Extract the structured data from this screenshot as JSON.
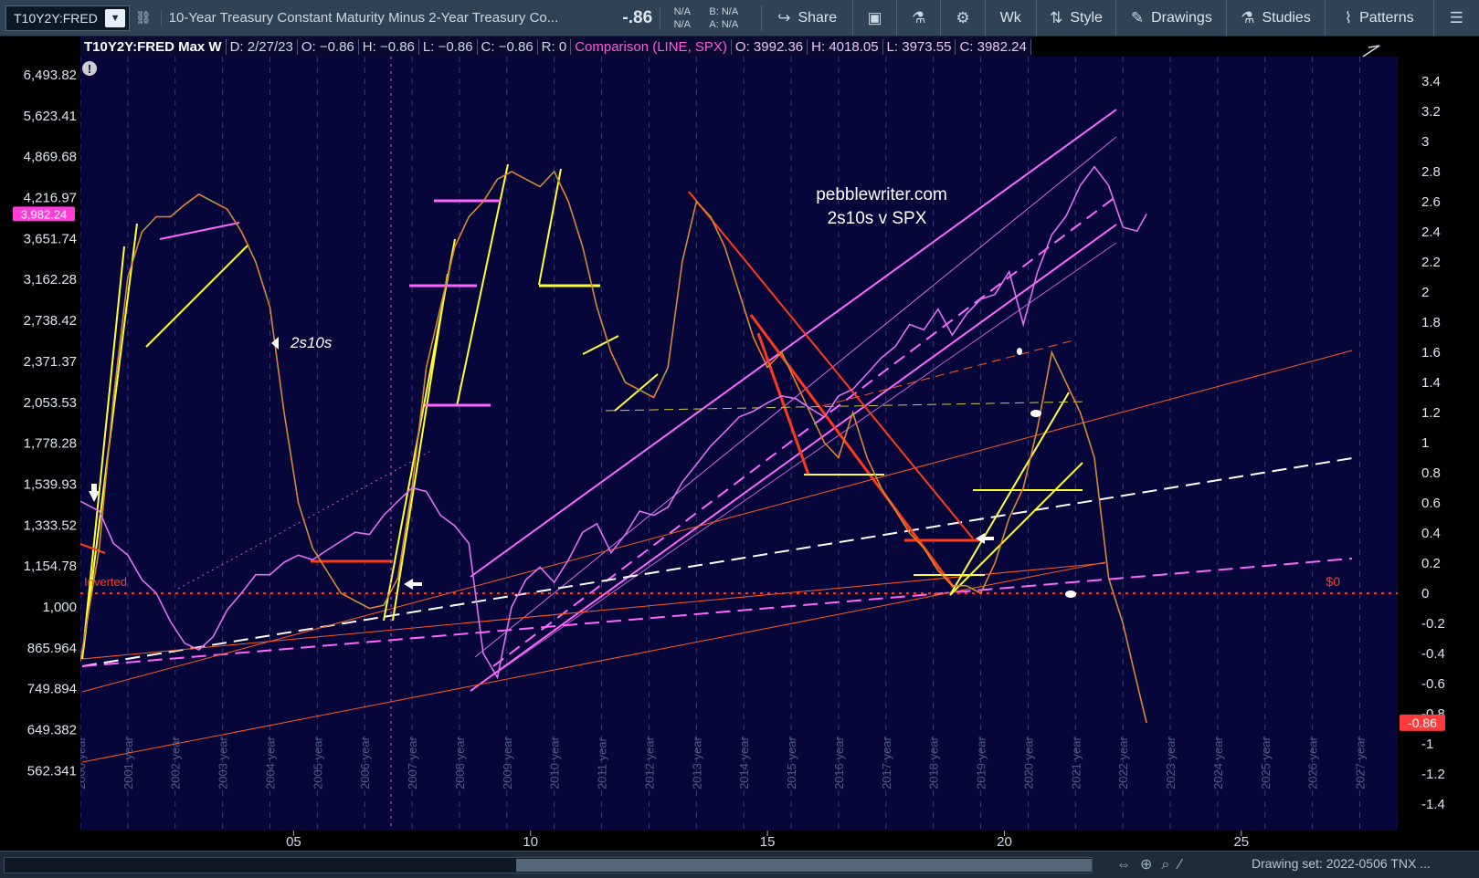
{
  "toolbar": {
    "symbol": "T10Y2Y:FRED",
    "link_icon": "link-icon",
    "description": "10-Year Treasury Constant Maturity Minus 2-Year Treasury Co...",
    "last": "-.86",
    "bid_na": "N/A",
    "ask_na": "N/A",
    "bid": "B: N/A",
    "ask": "A: N/A",
    "share_label": "Share",
    "wk_label": "Wk",
    "style_label": "Style",
    "drawings_label": "Drawings",
    "studies_label": "Studies",
    "patterns_label": "Patterns"
  },
  "header": {
    "symbol": "T10Y2Y:FRED Max W",
    "date": "D: 2/27/23",
    "open": "O: −0.86",
    "high": "H: −0.86",
    "low": "L: −0.86",
    "close": "C: −0.86",
    "r": "R: 0",
    "comparison": "Comparison (LINE, SPX)",
    "cmp_open": "O: 3992.36",
    "cmp_high": "H: 4018.05",
    "cmp_low": "L: 3973.55",
    "cmp_close": "C: 3982.24"
  },
  "bottom": {
    "drawing_set": "Drawing set: 2022-0506 TNX ..."
  },
  "chart_data": {
    "type": "line",
    "title": "pebblewriter.com",
    "subtitle": "2s10s v SPX",
    "annotation_2s10s": "2s10s",
    "inverted_label": "Inverted",
    "zero_label": "$0",
    "left_axis_label": "SPX",
    "left_axis_ticks": [
      "6,493.82",
      "5,623.41",
      "4,869.68",
      "4,216.97",
      "3,651.74",
      "3,162.28",
      "2,738.42",
      "2,371.37",
      "2,053.53",
      "1,778.28",
      "1,539.93",
      "1,333.52",
      "1,154.78",
      "1,000",
      "865.964",
      "749.894",
      "649.382",
      "562.341"
    ],
    "left_axis_scale": "log",
    "left_current": "3,982.24",
    "right_axis_ticks": [
      "3.4",
      "3.2",
      "3",
      "2.8",
      "2.6",
      "2.4",
      "2.2",
      "2",
      "1.8",
      "1.6",
      "1.4",
      "1.2",
      "1",
      "0.8",
      "0.6",
      "0.4",
      "0.2",
      "0",
      "-0.2",
      "-0.4",
      "-0.6",
      "-0.8",
      "-1",
      "-1.2",
      "-1.4"
    ],
    "right_current": "-0.86",
    "ylim": [
      -1.4,
      3.5
    ],
    "x_major_ticks": [
      "05",
      "10",
      "15",
      "20",
      "25"
    ],
    "x_year_labels": [
      "2000 year",
      "2001 year",
      "2002 year",
      "2003 year",
      "2004 year",
      "2005 year",
      "2006 year",
      "2007 year",
      "2008 year",
      "2009 year",
      "2010 year",
      "2011 year",
      "2012 year",
      "2013 year",
      "2014 year",
      "2015 year",
      "2016 year",
      "2017 year",
      "2018 year",
      "2019 year",
      "2020 year",
      "2021 year",
      "2022 year",
      "2023 year",
      "2024 year",
      "2025 year",
      "2026 year",
      "2027 year"
    ],
    "xlim": [
      2000.5,
      2028.3
    ],
    "series": [
      {
        "name": "T10Y2Y:FRED",
        "axis": "right",
        "x": [
          2000.5,
          2000.9,
          2001.2,
          2001.5,
          2001.8,
          2002.1,
          2002.4,
          2002.7,
          2003.0,
          2003.3,
          2003.6,
          2003.9,
          2004.2,
          2004.5,
          2004.8,
          2005.1,
          2005.4,
          2005.7,
          2006.0,
          2006.3,
          2006.6,
          2006.9,
          2007.2,
          2007.5,
          2007.8,
          2008.1,
          2008.4,
          2008.7,
          2009.0,
          2009.3,
          2009.6,
          2009.9,
          2010.2,
          2010.5,
          2010.8,
          2011.1,
          2011.4,
          2011.7,
          2012.0,
          2012.3,
          2012.6,
          2012.9,
          2013.2,
          2013.5,
          2013.8,
          2014.1,
          2014.4,
          2014.7,
          2015.0,
          2015.3,
          2015.6,
          2015.9,
          2016.2,
          2016.5,
          2016.8,
          2017.1,
          2017.4,
          2017.7,
          2018.0,
          2018.3,
          2018.6,
          2018.9,
          2019.2,
          2019.5,
          2019.8,
          2020.1,
          2020.4,
          2020.7,
          2021.0,
          2021.3,
          2021.6,
          2021.9,
          2022.2,
          2022.5,
          2022.8,
          2023.0
        ],
        "values": [
          -0.45,
          0.3,
          1.3,
          2.1,
          2.4,
          2.5,
          2.5,
          2.58,
          2.65,
          2.6,
          2.55,
          2.4,
          2.2,
          1.9,
          1.2,
          0.6,
          0.3,
          0.15,
          0.0,
          -0.05,
          -0.1,
          -0.08,
          0.1,
          0.7,
          1.5,
          1.9,
          2.3,
          2.5,
          2.6,
          2.75,
          2.8,
          2.75,
          2.7,
          2.8,
          2.6,
          2.3,
          1.9,
          1.6,
          1.4,
          1.35,
          1.3,
          1.5,
          2.2,
          2.6,
          2.5,
          2.3,
          2.0,
          1.7,
          1.5,
          1.6,
          1.4,
          1.2,
          1.0,
          0.9,
          1.2,
          0.9,
          0.7,
          0.55,
          0.4,
          0.3,
          0.15,
          0.05,
          0.05,
          0.0,
          0.2,
          0.5,
          0.7,
          1.1,
          1.6,
          1.4,
          1.2,
          0.9,
          0.1,
          -0.2,
          -0.6,
          -0.86
        ]
      },
      {
        "name": "SPX",
        "axis": "left",
        "x": [
          2000.5,
          2000.9,
          2001.2,
          2001.5,
          2001.8,
          2002.1,
          2002.4,
          2002.7,
          2003.0,
          2003.3,
          2003.6,
          2003.9,
          2004.2,
          2004.5,
          2004.8,
          2005.1,
          2005.4,
          2005.7,
          2006.0,
          2006.3,
          2006.6,
          2006.9,
          2007.2,
          2007.5,
          2007.8,
          2008.1,
          2008.4,
          2008.7,
          2009.0,
          2009.3,
          2009.6,
          2009.9,
          2010.2,
          2010.5,
          2010.8,
          2011.1,
          2011.4,
          2011.7,
          2012.0,
          2012.3,
          2012.6,
          2012.9,
          2013.2,
          2013.5,
          2013.8,
          2014.1,
          2014.4,
          2014.7,
          2015.0,
          2015.3,
          2015.6,
          2015.9,
          2016.2,
          2016.5,
          2016.8,
          2017.1,
          2017.4,
          2017.7,
          2018.0,
          2018.3,
          2018.6,
          2018.9,
          2019.2,
          2019.5,
          2019.8,
          2020.1,
          2020.4,
          2020.7,
          2021.0,
          2021.3,
          2021.6,
          2021.9,
          2022.2,
          2022.5,
          2022.8,
          2023.0
        ],
        "values": [
          1450,
          1400,
          1250,
          1200,
          1100,
          1050,
          950,
          880,
          860,
          900,
          990,
          1050,
          1120,
          1120,
          1170,
          1200,
          1180,
          1220,
          1260,
          1300,
          1290,
          1380,
          1450,
          1520,
          1500,
          1380,
          1330,
          1250,
          850,
          780,
          1000,
          1100,
          1150,
          1090,
          1180,
          1300,
          1340,
          1210,
          1290,
          1400,
          1380,
          1420,
          1550,
          1650,
          1760,
          1850,
          1950,
          1990,
          2050,
          2100,
          2080,
          2010,
          1950,
          2100,
          2150,
          2270,
          2400,
          2500,
          2700,
          2650,
          2850,
          2600,
          2800,
          2950,
          3000,
          3250,
          2700,
          3250,
          3700,
          3950,
          4400,
          4700,
          4400,
          3800,
          3750,
          3982
        ]
      }
    ],
    "grid": true,
    "legend": "none"
  }
}
